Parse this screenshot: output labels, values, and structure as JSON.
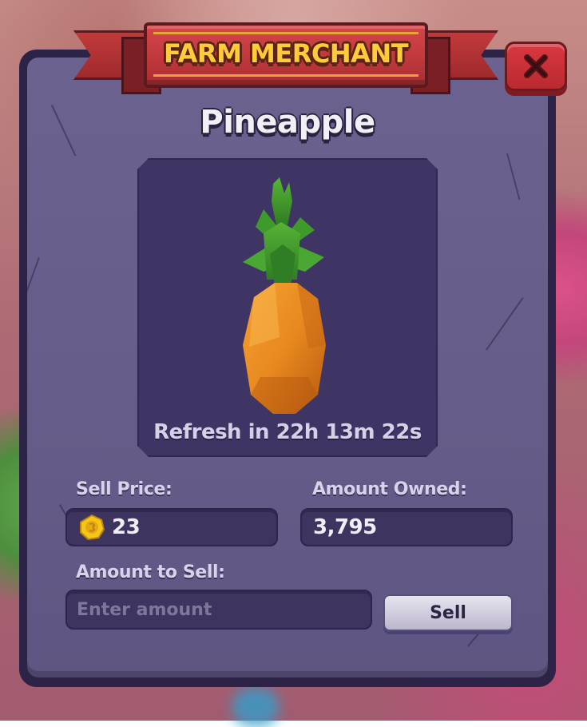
{
  "header": {
    "title": "FARM MERCHANT",
    "close_icon": "close-x-icon"
  },
  "item": {
    "name": "Pineapple",
    "image_icon": "pineapple-icon",
    "refresh_text": "Refresh in 22h 13m 22s"
  },
  "sell_price": {
    "label": "Sell Price:",
    "value": "23",
    "currency_icon": "gold-coin-icon"
  },
  "amount_owned": {
    "label": "Amount Owned:",
    "value": "3,795"
  },
  "amount_to_sell": {
    "label": "Amount to Sell:",
    "placeholder": "Enter amount",
    "value": ""
  },
  "sell_button": {
    "label": "Sell"
  },
  "colors": {
    "panel": "#665c89",
    "panel_border": "#2c2346",
    "banner_red": "#c23a3e",
    "banner_text": "#ffcb3a",
    "close_red": "#d9383f",
    "field_bg": "#3d3460"
  }
}
